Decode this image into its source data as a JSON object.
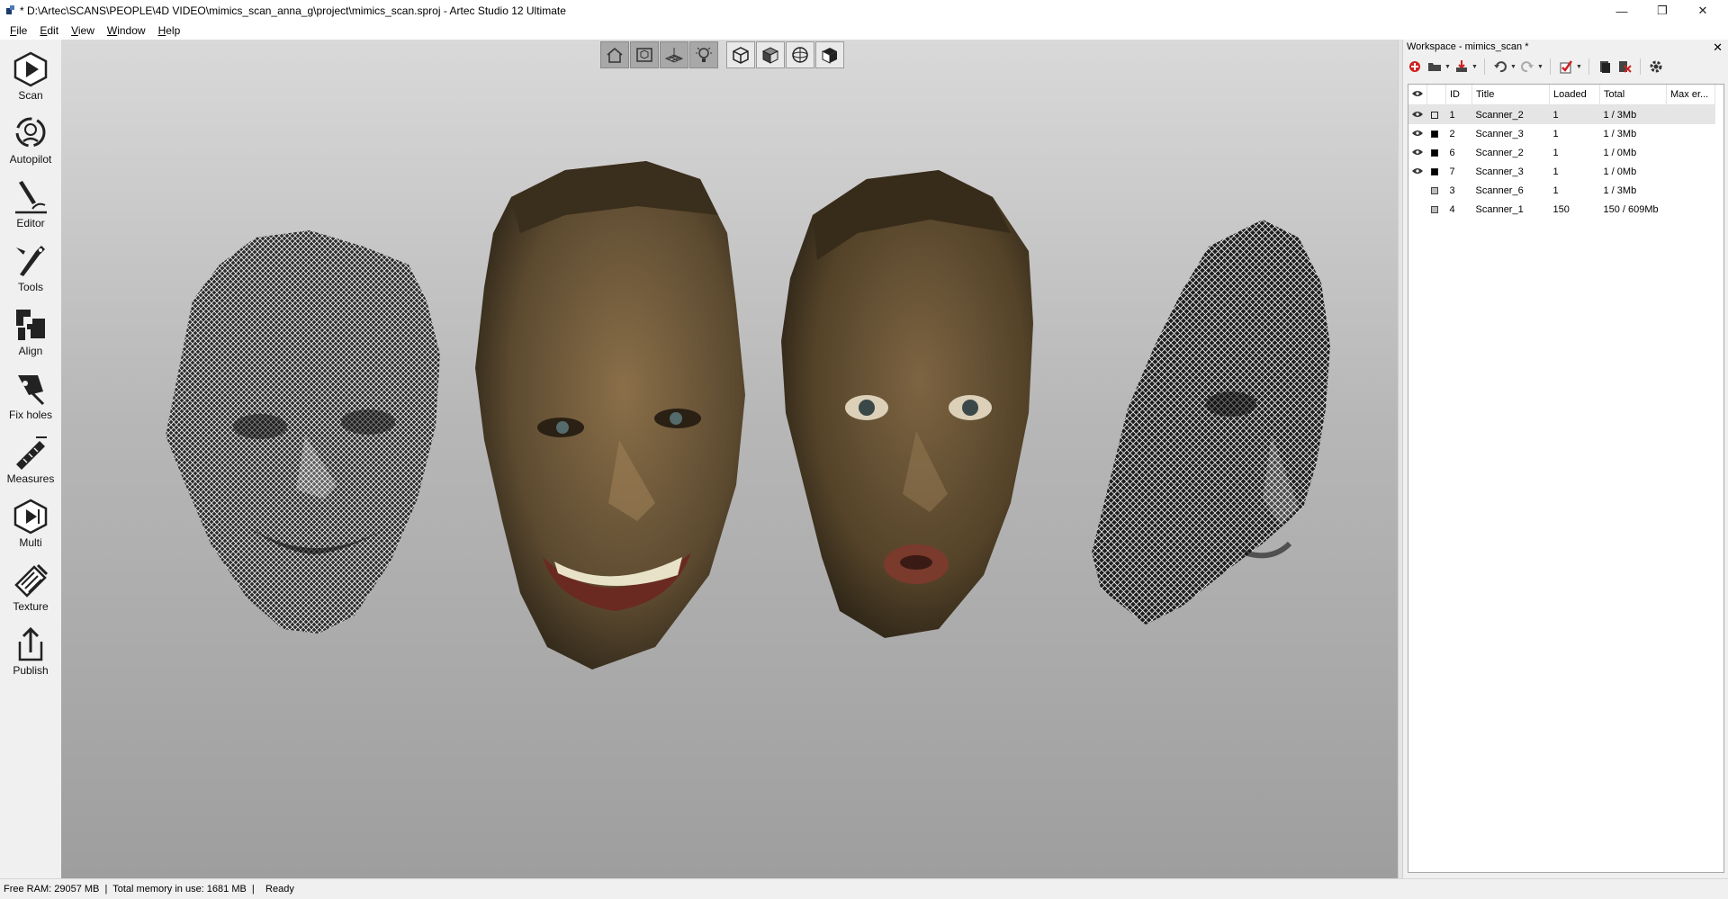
{
  "window": {
    "title": "* D:\\Artec\\SCANS\\PEOPLE\\4D VIDEO\\mimics_scan_anna_g\\project\\mimics_scan.sproj - Artec Studio 12 Ultimate",
    "minimize_glyph": "—",
    "restore_glyph": "❐",
    "close_glyph": "✕"
  },
  "menu": {
    "file": {
      "u": "F",
      "rest": "ile"
    },
    "edit": {
      "u": "E",
      "rest": "dit"
    },
    "view": {
      "u": "V",
      "rest": "iew"
    },
    "window": {
      "u": "W",
      "rest": "indow"
    },
    "help": {
      "u": "H",
      "rest": "elp"
    }
  },
  "left_toolbar": [
    {
      "label": "Scan",
      "icon": "play-icon"
    },
    {
      "label": "Autopilot",
      "icon": "autopilot-icon"
    },
    {
      "label": "Editor",
      "icon": "eraser-icon"
    },
    {
      "label": "Tools",
      "icon": "tools-icon"
    },
    {
      "label": "Align",
      "icon": "align-icon"
    },
    {
      "label": "Fix holes",
      "icon": "fix-holes-icon"
    },
    {
      "label": "Measures",
      "icon": "measures-icon"
    },
    {
      "label": "Multi",
      "icon": "multi-icon"
    },
    {
      "label": "Texture",
      "icon": "texture-icon"
    },
    {
      "label": "Publish",
      "icon": "publish-icon"
    }
  ],
  "view_toolbar": [
    "home-icon",
    "fit-view-icon",
    "grid-icon",
    "light-icon",
    "wireframe-cube-icon",
    "solid-cube-icon",
    "sphere-icon",
    "textured-cube-icon"
  ],
  "workspace": {
    "title": "Workspace - mimics_scan *",
    "close_glyph": "✕",
    "columns": [
      "ID",
      "Title",
      "Loaded",
      "Total",
      "Max er..."
    ],
    "rows": [
      {
        "id": "1",
        "title": "Scanner_2",
        "loaded": "1",
        "total": "1 / 3Mb",
        "visible": true,
        "check": "empty",
        "selected": true
      },
      {
        "id": "2",
        "title": "Scanner_3",
        "loaded": "1",
        "total": "1 / 3Mb",
        "visible": true,
        "check": "on",
        "selected": false
      },
      {
        "id": "6",
        "title": "Scanner_2",
        "loaded": "1",
        "total": "1 / 0Mb",
        "visible": true,
        "check": "on",
        "selected": false
      },
      {
        "id": "7",
        "title": "Scanner_3",
        "loaded": "1",
        "total": "1 / 0Mb",
        "visible": true,
        "check": "on",
        "selected": false
      },
      {
        "id": "3",
        "title": "Scanner_6",
        "loaded": "1",
        "total": "1 / 3Mb",
        "visible": false,
        "check": "grey",
        "selected": false
      },
      {
        "id": "4",
        "title": "Scanner_1",
        "loaded": "150",
        "total": "150 / 609Mb",
        "visible": false,
        "check": "grey",
        "selected": false
      }
    ]
  },
  "status": {
    "text": "Free RAM: 29057 MB  |  Total memory in use: 1681 MB  |    Ready"
  },
  "colors": {
    "accent_red": "#d02020",
    "face_skin": "#6b5536"
  }
}
